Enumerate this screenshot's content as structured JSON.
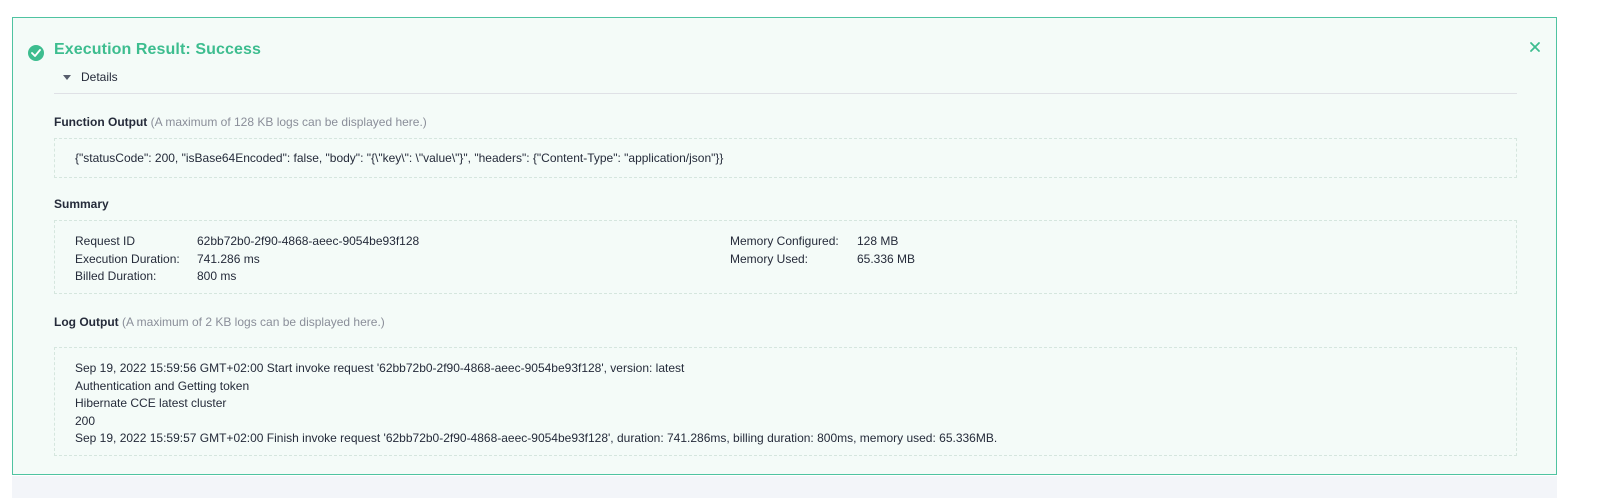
{
  "result": {
    "title": "Execution Result: Success",
    "status": "success",
    "status_icon": "check-circle-icon",
    "close_icon": "close-icon",
    "accent_color": "#3dbd8f"
  },
  "details": {
    "label": "Details",
    "expanded": true
  },
  "function_output": {
    "heading": "Function Output",
    "hint": "(A maximum of 128 KB logs can be displayed here.)",
    "text": "{\"statusCode\": 200, \"isBase64Encoded\": false, \"body\": \"{\\\"key\\\": \\\"value\\\"}\", \"headers\": {\"Content-Type\": \"application/json\"}}"
  },
  "summary": {
    "heading": "Summary",
    "left": [
      {
        "label": "Request ID",
        "value": "62bb72b0-2f90-4868-aeec-9054be93f128"
      },
      {
        "label": "Execution Duration:",
        "value": "741.286 ms"
      },
      {
        "label": "Billed Duration:",
        "value": "800 ms"
      }
    ],
    "right": [
      {
        "label": "Memory Configured:",
        "value": "128 MB"
      },
      {
        "label": "Memory Used:",
        "value": "65.336 MB"
      }
    ]
  },
  "log_output": {
    "heading": "Log Output",
    "hint": "(A maximum of 2 KB logs can be displayed here.)",
    "lines": [
      "Sep 19, 2022 15:59:56 GMT+02:00 Start invoke request '62bb72b0-2f90-4868-aeec-9054be93f128', version: latest",
      "Authentication and Getting token",
      "Hibernate CCE latest cluster",
      "200",
      "Sep 19, 2022 15:59:57 GMT+02:00 Finish invoke request '62bb72b0-2f90-4868-aeec-9054be93f128', duration: 741.286ms, billing duration: 800ms, memory used: 65.336MB."
    ]
  }
}
